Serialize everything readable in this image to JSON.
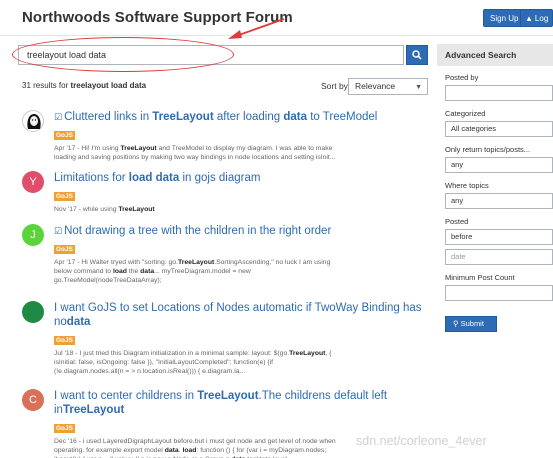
{
  "header": {
    "site_title": "Northwoods Software Support Forum",
    "signup_label": "Sign Up",
    "login_label": "Log"
  },
  "search": {
    "value": "treelayout load data",
    "button_icon": "search-icon"
  },
  "results_bar": {
    "count_text": "31 results for",
    "query": "treelayout load data",
    "sort_label": "Sort by",
    "sort_value": "Relevance"
  },
  "results": [
    {
      "avatar_color": "#ffffff",
      "avatar_letter": "",
      "has_check": true,
      "title_parts": [
        "Cluttered links in ",
        "TreeLayout",
        " after loading ",
        "data",
        " to TreeModel"
      ],
      "tag": "GoJS",
      "snippet_lines": [
        [
          "Apr '17 - Hi! I'm using ",
          "TreeLayout",
          " and TreeModel to display my diagram. I was able to make"
        ],
        [
          "loading and saving positions by making two way bindings in node locations and setting isInit..."
        ]
      ]
    },
    {
      "avatar_color": "#e04e6b",
      "avatar_letter": "Y",
      "has_check": false,
      "title_parts": [
        "Limitations for ",
        "load data",
        " in gojs diagram"
      ],
      "tag": "GoJS",
      "snippet_lines": [
        [
          "Nov '17 - while using ",
          "TreeLayout"
        ]
      ]
    },
    {
      "avatar_color": "#5bd43b",
      "avatar_letter": "J",
      "has_check": true,
      "title_parts": [
        "Not drawing a tree with the children in the right order"
      ],
      "tag": "GoJS",
      "snippet_lines": [
        [
          "Apr '17 - Hi Walter tryed with \"sorting: go.",
          "TreeLayout",
          ".SortingAscending,\" no luck I am using"
        ],
        [
          "below command to ",
          "load",
          " the ",
          "data",
          "... myTreeDiagram.model = new"
        ],
        [
          "go.TreeModel(nodeTreeDataArray);"
        ]
      ]
    },
    {
      "avatar_color": "#1e8a43",
      "avatar_letter": "",
      "has_check": false,
      "title_parts": [
        "I want GoJS to set Locations of Nodes automatic if TwoWay Binding has no",
        "data"
      ],
      "tag": "GoJS",
      "snippet_lines": [
        [
          "Jul '18 - I just tried this Diagram initialization in a minimal sample: layout: $(go.",
          "TreeLayout",
          ", {"
        ],
        [
          "isInitial: false, isOngoing: false }), \"InitialLayoutCompleted\": function(e) {if"
        ],
        [
          "(!e.diagram.nodes.all(n = > n.location.isReal())) { e.diagram.la..."
        ]
      ]
    },
    {
      "avatar_color": "#d9705a",
      "avatar_letter": "C",
      "has_check": false,
      "title_parts": [
        "I want to center childrens in ",
        "TreeLayout",
        ".The childrens default left in",
        "TreeLayout"
      ],
      "tag": "GoJS",
      "snippet_lines": [
        [
          "Dec '16 - i used LayeredDigraphLayout before,but i must get node and get level of node when"
        ],
        [
          "operating. for example export model ",
          "data",
          ". ",
          "load",
          ": function () { for (var i = myDiagram.nodes;"
        ],
        [
          "it.next();) { var n = it.value; // n is now a Node or a Group n.",
          "data",
          ".tasktoto level ="
        ]
      ]
    }
  ],
  "sidebar": {
    "title": "Advanced Search",
    "posted_by_label": "Posted by",
    "posted_by_value": "",
    "categorized_label": "Categorized",
    "categorized_value": "All categories",
    "only_return_label": "Only return topics/posts...",
    "only_return_value": "any",
    "where_topics_label": "Where topics",
    "where_topics_value": "any",
    "posted_label": "Posted",
    "posted_value": "before",
    "date_placeholder": "date",
    "min_post_label": "Minimum Post Count",
    "min_post_value": "",
    "submit_label": "Submit"
  },
  "watermark": "sdn.net/corleone_4ever"
}
